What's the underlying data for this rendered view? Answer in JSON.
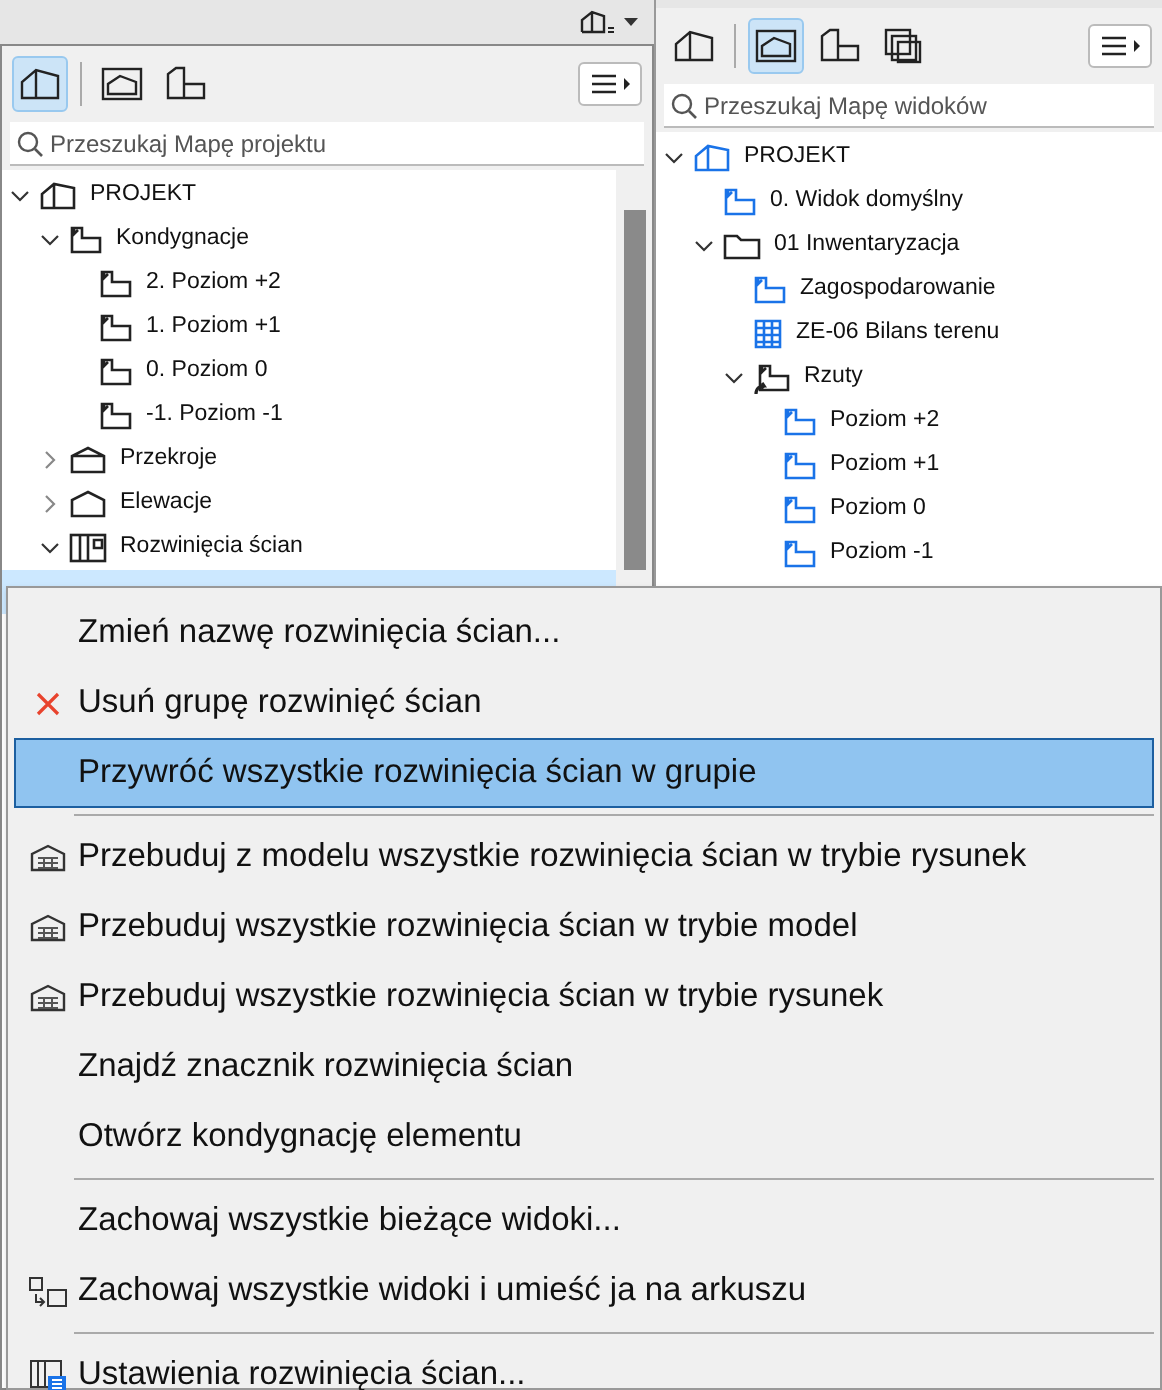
{
  "left_panel": {
    "tabs": [
      {
        "kind": "project",
        "selected": true
      },
      {
        "kind": "view",
        "selected": false
      },
      {
        "kind": "layout",
        "selected": false
      }
    ],
    "search": {
      "placeholder": "Przeszukaj Mapę projektu"
    },
    "tree": [
      {
        "label": "PROJEKT",
        "kind": "project",
        "expanded": true,
        "selected": false,
        "children": [
          {
            "label": "Kondygnacje",
            "kind": "story",
            "expanded": true,
            "selected": false,
            "children": [
              {
                "label": "2. Poziom +2",
                "kind": "story",
                "selected": false
              },
              {
                "label": "1. Poziom +1",
                "kind": "story",
                "selected": false
              },
              {
                "label": "0. Poziom 0",
                "kind": "story",
                "selected": false
              },
              {
                "label": "-1. Poziom -1",
                "kind": "story",
                "selected": false
              }
            ]
          },
          {
            "label": "Przekroje",
            "kind": "section",
            "expanded": false,
            "selected": false
          },
          {
            "label": "Elewacje",
            "kind": "elevation",
            "expanded": false,
            "selected": false
          },
          {
            "label": "Rozwinięcia ścian",
            "kind": "wall",
            "expanded": true,
            "selected": false,
            "children": [
              {
                "kind": "none",
                "selected": true
              }
            ]
          }
        ]
      }
    ]
  },
  "right_panel": {
    "tabs": [
      {
        "kind": "project",
        "selected": false
      },
      {
        "kind": "view",
        "selected": true
      },
      {
        "kind": "layout",
        "selected": false
      },
      {
        "kind": "publisher",
        "selected": false
      }
    ],
    "search": {
      "placeholder": "Przeszukaj Mapę widoków"
    },
    "tree": [
      {
        "label": "PROJEKT",
        "kind": "project",
        "expanded": true,
        "children": [
          {
            "label": "0. Widok domyślny",
            "kind": "view"
          },
          {
            "label": "01 Inwentaryzacja",
            "kind": "folder",
            "expanded": true,
            "children": [
              {
                "label": "Zagospodarowanie",
                "kind": "view"
              },
              {
                "label": "ZE-06 Bilans terenu",
                "kind": "schedule"
              },
              {
                "label": "Rzuty",
                "kind": "clone",
                "expanded": true,
                "children": [
                  {
                    "label": "Poziom +2",
                    "kind": "view"
                  },
                  {
                    "label": "Poziom +1",
                    "kind": "view"
                  },
                  {
                    "label": "Poziom 0",
                    "kind": "view"
                  },
                  {
                    "label": "Poziom -1",
                    "kind": "view"
                  }
                ]
              }
            ]
          }
        ]
      }
    ]
  },
  "context_menu": [
    {
      "kind": "plain",
      "label": "Zmień nazwę rozwinięcia ścian...",
      "selected": false
    },
    {
      "kind": "delete",
      "label": "Usuń grupę rozwinięć ścian",
      "selected": false
    },
    {
      "kind": "plain",
      "label": "Przywróć wszystkie rozwinięcia ścian w grupie",
      "selected": true
    },
    {
      "kind": "separator"
    },
    {
      "kind": "rebuild",
      "label": "Przebuduj z modelu wszystkie rozwinięcia ścian w trybie rysunek",
      "selected": false
    },
    {
      "kind": "rebuild",
      "label": "Przebuduj wszystkie rozwinięcia ścian w trybie model",
      "selected": false
    },
    {
      "kind": "rebuild",
      "label": "Przebuduj wszystkie rozwinięcia ścian w trybie rysunek",
      "selected": false
    },
    {
      "kind": "plain",
      "label": "Znajdź znacznik rozwinięcia ścian",
      "selected": false
    },
    {
      "kind": "plain",
      "label": "Otwórz kondygnację elementu",
      "selected": false
    },
    {
      "kind": "separator"
    },
    {
      "kind": "plain",
      "label": "Zachowaj wszystkie bieżące widoki...",
      "selected": false
    },
    {
      "kind": "save-to-layout",
      "label": "Zachowaj wszystkie widoki i umieść ja na arkuszu",
      "selected": false
    },
    {
      "kind": "separator"
    },
    {
      "kind": "settings",
      "label": "Ustawienia rozwinięcia ścian...",
      "selected": false
    }
  ]
}
